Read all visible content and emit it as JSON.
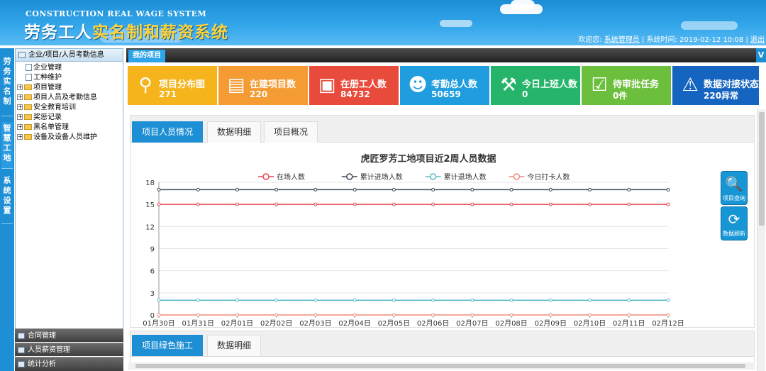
{
  "header": {
    "title_en": "CONSTRUCTION REAL WAGE SYSTEM",
    "title_cn_part1": "劳务工人",
    "title_cn_part2": "实名制和薪资系统",
    "welcome": "欢迎您:",
    "user": "系统管理员",
    "time_label": "系统时间:",
    "time": "2019-02-12 10:08",
    "logout": "退出"
  },
  "left_tabs": [
    {
      "label": "劳务实名制"
    },
    {
      "label": "智慧工地"
    },
    {
      "label": "系统设置"
    }
  ],
  "tree": {
    "header": "企业/项目/人员考勤信息",
    "nodes": [
      {
        "label": "企业管理",
        "type": "doc"
      },
      {
        "label": "工种维护",
        "type": "doc"
      },
      {
        "label": "项目管理",
        "type": "folder"
      },
      {
        "label": "项目人员及考勤信息",
        "type": "folder"
      },
      {
        "label": "安全教育培训",
        "type": "folder"
      },
      {
        "label": "奖惩记录",
        "type": "folder"
      },
      {
        "label": "黑名单管理",
        "type": "folder"
      },
      {
        "label": "设备及设备人员维护",
        "type": "folder"
      }
    ]
  },
  "bottom_menus": [
    {
      "label": "合同管理"
    },
    {
      "label": "人员薪资管理"
    },
    {
      "label": "统计分析"
    }
  ],
  "main": {
    "tab_label": "我的项目",
    "tab_v": "V",
    "cards": [
      {
        "label": "项目分布图",
        "value": "271",
        "color": "#f5b41b",
        "icon": "map-pin-icon"
      },
      {
        "label": "在建项目数",
        "value": "220",
        "color": "#f49b33",
        "icon": "document-icon"
      },
      {
        "label": "在册工人数",
        "value": "84732",
        "color": "#e84b3c",
        "icon": "id-card-icon"
      },
      {
        "label": "考勤总人数",
        "value": "50659",
        "color": "#1f9ddf",
        "icon": "worker-icon"
      },
      {
        "label": "今日上班人数",
        "value": "0",
        "color": "#25b46a",
        "icon": "digging-worker-icon"
      },
      {
        "label": "待审批任务",
        "value": "0件",
        "color": "#6cbf3c",
        "icon": "checklist-icon"
      },
      {
        "label": "数据对接状态",
        "value": "220异常",
        "color": "#1565c0",
        "icon": "warning-icon"
      }
    ],
    "panel1_tabs": [
      {
        "label": "项目人员情况",
        "active": true
      },
      {
        "label": "数据明细",
        "active": false
      },
      {
        "label": "项目概况",
        "active": false
      }
    ],
    "panel2_tabs": [
      {
        "label": "项目绿色施工",
        "active": true
      },
      {
        "label": "数据明细",
        "active": false
      }
    ],
    "side_buttons": [
      {
        "label": "项目查询",
        "icon": "search-icon"
      },
      {
        "label": "数据刷新",
        "icon": "refresh-icon"
      }
    ]
  },
  "chart_data": {
    "type": "line",
    "title": "虎匠罗芳工地项目近2周人员数据",
    "legend_position": "top-center",
    "grid": true,
    "ylim": [
      0,
      18
    ],
    "yticks": [
      0,
      3,
      6,
      9,
      12,
      15,
      18
    ],
    "categories": [
      "01月30日",
      "01月31日",
      "02月01日",
      "02月02日",
      "02月03日",
      "02月04日",
      "02月05日",
      "02月06日",
      "02月07日",
      "02月08日",
      "02月09日",
      "02月10日",
      "02月11日",
      "02月12日"
    ],
    "series": [
      {
        "name": "在场人数",
        "color": "#e8454c",
        "values": [
          15,
          15,
          15,
          15,
          15,
          15,
          15,
          15,
          15,
          15,
          15,
          15,
          15,
          15
        ]
      },
      {
        "name": "累计进场人数",
        "color": "#3d4a5a",
        "values": [
          17,
          17,
          17,
          17,
          17,
          17,
          17,
          17,
          17,
          17,
          17,
          17,
          17,
          17
        ]
      },
      {
        "name": "累计退场人数",
        "color": "#5ab8c9",
        "values": [
          2,
          2,
          2,
          2,
          2,
          2,
          2,
          2,
          2,
          2,
          2,
          2,
          2,
          2
        ]
      },
      {
        "name": "今日打卡人数",
        "color": "#f08a7a",
        "values": [
          0,
          0,
          0,
          0,
          0,
          0,
          0,
          0,
          0,
          0,
          0,
          0,
          0,
          0
        ]
      }
    ]
  }
}
